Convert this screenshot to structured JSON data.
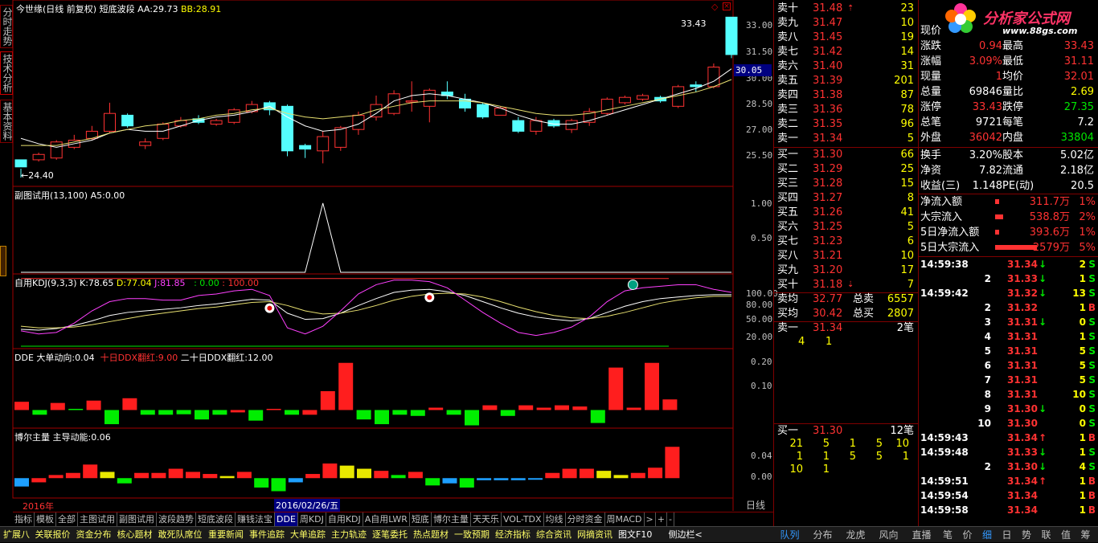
{
  "side_tabs": [
    {
      "label": "分时走势"
    },
    {
      "label": "技术分析"
    },
    {
      "label": "基本资料"
    }
  ],
  "main_panel": {
    "stock": "今世缘",
    "period": "(日线 前复权)",
    "indicator": "短底波段",
    "aa_label": "AA:",
    "aa_value": "29.73",
    "bb_label": "BB:",
    "bb_value": "28.91",
    "high_marker": "33.43",
    "low_marker": "24.40",
    "yaxis": [
      "33.00",
      "31.50",
      "30.00",
      "28.50",
      "27.00",
      "25.50"
    ],
    "current_price": "30.05"
  },
  "sub_panel": {
    "title": "副图试用(13,100)",
    "a5_label": "A5:",
    "a5_value": "0.00",
    "yaxis": [
      "1.00",
      "0.50"
    ]
  },
  "kdj_panel": {
    "title": "自用KDJ(9,3,3)",
    "k_label": "K:",
    "k_value": "78.65",
    "d_label": "D:",
    "d_value": "77.04",
    "j_label": "J:",
    "j_value": "81.85",
    "c1": ": 0.00",
    "c2": ": 100.00",
    "yaxis": [
      "100.00",
      "80.00",
      "50.00",
      "20.00"
    ]
  },
  "dde_panel": {
    "title": "DDE",
    "l1": "大单动向:",
    "v1": "0.04",
    "l2": "十日DDX翻红:",
    "v2": "9.00",
    "l3": "二十日DDX翻红:",
    "v3": "12.00",
    "yaxis": [
      "0.20",
      "0.10"
    ]
  },
  "boer_panel": {
    "title": "博尔主量",
    "l1": "主导动能:",
    "v1": "0.06",
    "yaxis": [
      "0.04",
      "0.00"
    ]
  },
  "time_axis": {
    "year": "2016年",
    "cursor_date": "2016/02/26/五"
  },
  "chart_data": [
    {
      "type": "candlestick",
      "title": "今世缘 (日线 前复权) 短底波段",
      "ylim": [
        24.0,
        34.0
      ],
      "candles": [
        [
          25.4,
          25.0,
          24.4,
          24.9
        ],
        [
          25.4,
          25.7,
          25.3,
          25.8
        ],
        [
          25.5,
          26.4,
          25.4,
          26.5
        ],
        [
          26.1,
          26.5,
          26.0,
          26.8
        ],
        [
          26.6,
          27.0,
          26.5,
          27.3
        ],
        [
          27.0,
          28.0,
          26.9,
          28.6
        ],
        [
          27.9,
          27.3,
          27.2,
          28.0
        ],
        [
          26.2,
          26.4,
          26.0,
          26.6
        ],
        [
          26.6,
          27.4,
          26.5,
          27.5
        ],
        [
          27.3,
          27.6,
          27.2,
          27.8
        ],
        [
          27.7,
          27.5,
          27.4,
          27.9
        ],
        [
          27.4,
          27.6,
          27.3,
          27.7
        ],
        [
          27.5,
          28.2,
          27.4,
          28.3
        ],
        [
          28.1,
          28.5,
          28.0,
          28.7
        ],
        [
          28.6,
          28.2,
          27.9,
          28.7
        ],
        [
          28.4,
          25.9,
          25.6,
          28.5
        ],
        [
          26.2,
          26.0,
          25.5,
          26.3
        ],
        [
          25.9,
          26.7,
          25.2,
          27.0
        ],
        [
          26.1,
          27.2,
          25.9,
          27.3
        ],
        [
          27.1,
          27.9,
          26.8,
          28.1
        ],
        [
          27.8,
          28.5,
          27.6,
          29.0
        ],
        [
          28.0,
          29.1,
          27.9,
          29.3
        ],
        [
          28.7,
          28.7,
          28.1,
          29.8
        ],
        [
          28.4,
          29.3,
          27.5,
          29.4
        ],
        [
          29.2,
          29.0,
          28.8,
          29.8
        ],
        [
          28.8,
          28.3,
          28.1,
          29.1
        ],
        [
          28.5,
          27.8,
          27.7,
          28.6
        ],
        [
          27.9,
          28.3,
          27.9,
          28.4
        ],
        [
          27.6,
          27.0,
          26.9,
          27.8
        ],
        [
          27.0,
          27.6,
          26.8,
          27.8
        ],
        [
          27.6,
          27.3,
          27.2,
          27.7
        ],
        [
          27.1,
          27.6,
          26.9,
          27.7
        ],
        [
          27.5,
          28.1,
          27.3,
          28.3
        ],
        [
          28.0,
          28.8,
          27.9,
          28.9
        ],
        [
          28.6,
          28.9,
          28.5,
          29.0
        ],
        [
          28.8,
          29.0,
          28.7,
          29.1
        ],
        [
          28.9,
          28.7,
          28.6,
          29.0
        ],
        [
          28.4,
          29.5,
          28.3,
          29.6
        ],
        [
          29.6,
          29.5,
          29.2,
          29.8
        ],
        [
          29.5,
          30.6,
          29.4,
          30.8
        ],
        [
          33.4,
          31.3,
          31.1,
          33.4
        ]
      ],
      "ma_white": [
        26.6,
        26.3,
        26.1,
        26.3,
        26.5,
        26.9,
        27.1,
        27.0,
        27.0,
        27.3,
        27.6,
        27.8,
        27.9,
        28.1,
        28.4,
        27.8,
        27.3,
        27.0,
        27.1,
        27.4,
        28.0,
        28.7,
        29.0,
        29.1,
        29.0,
        28.8,
        28.6,
        28.3,
        27.9,
        27.6,
        27.4,
        27.4,
        27.6,
        27.9,
        28.2,
        28.5,
        28.8,
        29.1,
        29.4,
        29.8,
        30.5
      ],
      "ma_yellow": [
        26.2,
        26.2,
        26.2,
        26.4,
        26.6,
        26.9,
        27.1,
        27.3,
        27.4,
        27.6,
        27.7,
        27.9,
        28.0,
        28.2,
        28.3,
        28.0,
        27.8,
        27.7,
        27.8,
        27.9,
        28.2,
        28.4,
        28.6,
        28.7,
        28.7,
        28.7,
        28.6,
        28.4,
        28.2,
        28.0,
        27.9,
        27.9,
        28.0,
        28.2,
        28.4,
        28.6,
        28.8,
        29.0,
        29.2,
        29.5,
        29.9
      ]
    },
    {
      "type": "line",
      "title": "副图试用(13,100)",
      "ylim": [
        0,
        1.15
      ],
      "values": [
        0,
        0,
        0,
        0,
        0,
        0,
        0,
        0,
        0,
        0,
        0,
        0,
        0,
        0,
        0,
        0,
        0,
        1,
        0,
        0,
        0,
        0,
        0,
        0,
        0,
        0,
        0,
        0,
        0,
        0,
        0,
        0,
        0,
        0,
        0,
        0,
        0,
        0,
        0,
        0,
        0
      ]
    },
    {
      "type": "line",
      "title": "自用KDJ(9,3,3)",
      "ylim": [
        10,
        105
      ],
      "series": [
        {
          "name": "K",
          "values": [
            34,
            33,
            35,
            39,
            45,
            52,
            56,
            58,
            60,
            62,
            65,
            67,
            70,
            73,
            72,
            55,
            47,
            48,
            55,
            65,
            74,
            82,
            85,
            86,
            83,
            78,
            70,
            62,
            55,
            50,
            47,
            45,
            48,
            56,
            64,
            70,
            74,
            76,
            78,
            79,
            79
          ]
        },
        {
          "name": "D",
          "values": [
            38,
            36,
            36,
            37,
            40,
            44,
            48,
            52,
            55,
            58,
            61,
            63,
            66,
            69,
            70,
            65,
            58,
            54,
            55,
            59,
            65,
            72,
            77,
            80,
            81,
            80,
            76,
            70,
            63,
            57,
            52,
            49,
            48,
            51,
            56,
            62,
            68,
            72,
            75,
            77,
            77
          ]
        },
        {
          "name": "J",
          "values": [
            32,
            28,
            30,
            42,
            58,
            70,
            74,
            74,
            72,
            72,
            78,
            80,
            84,
            86,
            78,
            36,
            28,
            38,
            58,
            80,
            92,
            98,
            98,
            96,
            88,
            72,
            56,
            42,
            30,
            26,
            30,
            37,
            50,
            70,
            84,
            88,
            90,
            92,
            92,
            86,
            82
          ]
        }
      ],
      "signals": [
        {
          "index": 14,
          "type": "buy"
        },
        {
          "index": 23,
          "type": "buy"
        },
        {
          "index": 34,
          "type": "top"
        }
      ]
    },
    {
      "type": "bar",
      "title": "DDE",
      "ylim": [
        -0.07,
        0.24
      ],
      "values": [
        0.035,
        -0.02,
        0.03,
        0.005,
        0.04,
        -0.06,
        0.05,
        -0.02,
        -0.02,
        -0.018,
        -0.04,
        -0.02,
        -0.01,
        -0.045,
        0.005,
        -0.02,
        -0.02,
        0.08,
        0.2,
        -0.04,
        -0.06,
        -0.02,
        -0.025,
        0.01,
        -0.02,
        -0.065,
        0.02,
        -0.025,
        0.02,
        0.01,
        0.02,
        0.015,
        -0.055,
        0.18,
        0.01,
        0.2,
        0.045
      ],
      "colors": [
        "r",
        "g",
        "r",
        "g",
        "r",
        "g",
        "r",
        "g",
        "g",
        "g",
        "g",
        "g",
        "r",
        "g",
        "r",
        "g",
        "r",
        "r",
        "r",
        "g",
        "g",
        "g",
        "g",
        "r",
        "g",
        "g",
        "r",
        "g",
        "r",
        "r",
        "r",
        "r",
        "g",
        "r",
        "r",
        "r",
        "r"
      ]
    },
    {
      "type": "bar",
      "title": "博尔主量",
      "ylim": [
        -0.035,
        0.085
      ],
      "values": [
        -0.016,
        -0.008,
        0.006,
        0.01,
        0.026,
        0.012,
        -0.01,
        0.01,
        0.01,
        0.018,
        0.012,
        0.008,
        0.004,
        0.012,
        -0.018,
        -0.025,
        -0.008,
        0.008,
        0.028,
        0.024,
        0.018,
        0.014,
        0.006,
        0.012,
        -0.014,
        -0.01,
        -0.018,
        -0.004,
        -0.004,
        -0.004,
        -0.002,
        0.01,
        0.018,
        0.018,
        0.014,
        0.006,
        0.01,
        0.02,
        0.06
      ],
      "colors": [
        "c",
        "r",
        "r",
        "r",
        "r",
        "y",
        "g",
        "r",
        "r",
        "r",
        "r",
        "r",
        "y",
        "r",
        "g",
        "g",
        "c",
        "r",
        "r",
        "y",
        "y",
        "r",
        "g",
        "r",
        "g",
        "c",
        "g",
        "c",
        "c",
        "c",
        "c",
        "r",
        "r",
        "r",
        "y",
        "y",
        "r",
        "r",
        "r"
      ]
    }
  ],
  "orderbook": {
    "sells": [
      {
        "label": "卖十",
        "price": "31.48",
        "vol": "23",
        "arrow": "up"
      },
      {
        "label": "卖九",
        "price": "31.47",
        "vol": "10"
      },
      {
        "label": "卖八",
        "price": "31.45",
        "vol": "19"
      },
      {
        "label": "卖七",
        "price": "31.42",
        "vol": "14"
      },
      {
        "label": "卖六",
        "price": "31.40",
        "vol": "31"
      },
      {
        "label": "卖五",
        "price": "31.39",
        "vol": "201"
      },
      {
        "label": "卖四",
        "price": "31.38",
        "vol": "87"
      },
      {
        "label": "卖三",
        "price": "31.36",
        "vol": "78"
      },
      {
        "label": "卖二",
        "price": "31.35",
        "vol": "96"
      },
      {
        "label": "卖一",
        "price": "31.34",
        "vol": "5"
      }
    ],
    "buys": [
      {
        "label": "买一",
        "price": "31.30",
        "vol": "66"
      },
      {
        "label": "买二",
        "price": "31.29",
        "vol": "25"
      },
      {
        "label": "买三",
        "price": "31.28",
        "vol": "15"
      },
      {
        "label": "买四",
        "price": "31.27",
        "vol": "8"
      },
      {
        "label": "买五",
        "price": "31.26",
        "vol": "41"
      },
      {
        "label": "买六",
        "price": "31.25",
        "vol": "5"
      },
      {
        "label": "买七",
        "price": "31.23",
        "vol": "6"
      },
      {
        "label": "买八",
        "price": "31.21",
        "vol": "10"
      },
      {
        "label": "买九",
        "price": "31.20",
        "vol": "17"
      },
      {
        "label": "买十",
        "price": "31.18",
        "vol": "7",
        "arrow": "down"
      }
    ],
    "avg_sell_label": "卖均",
    "avg_sell": "32.77",
    "total_sell_label": "总卖",
    "total_sell": "6557",
    "avg_buy_label": "买均",
    "avg_buy": "30.42",
    "total_buy_label": "总买",
    "total_buy": "2807",
    "sell1_label": "卖一",
    "sell1_price": "31.34",
    "sell1_count": "2笔",
    "sell1_q1": "4",
    "sell1_q2": "1",
    "buy1_label": "买一",
    "buy1_price": "31.30",
    "buy1_count": "12笔",
    "buy1_queue": [
      [
        "21",
        "5",
        "1",
        "5",
        "10"
      ],
      [
        "1",
        "1",
        "5",
        "5",
        "1"
      ],
      [
        "10",
        "1",
        "",
        "",
        ""
      ]
    ]
  },
  "logo": {
    "text": "分析家公式网",
    "url": "www.88gs.com"
  },
  "quote": {
    "rows": [
      {
        "l1": "现价",
        "v1": "",
        "l2": "",
        "v2": ""
      },
      {
        "l1": "涨跌",
        "v1": "0.94",
        "l2": "最高",
        "v2": "33.43"
      },
      {
        "l1": "涨幅",
        "v1": "3.09%",
        "l2": "最低",
        "v2": "31.11"
      },
      {
        "l1": "现量",
        "v1": "1",
        "l2": "均价",
        "v2": "32.01"
      },
      {
        "l1": "总量",
        "v1": "69846",
        "l2": "量比",
        "v2": "2.69"
      },
      {
        "l1": "涨停",
        "v1": "33.43",
        "l2": "跌停",
        "v2": "27.35"
      },
      {
        "l1": "总笔",
        "v1": "9721",
        "l2": "每笔",
        "v2": "7.2"
      },
      {
        "l1": "外盘",
        "v1": "36042",
        "l2": "内盘",
        "v2": "33804"
      }
    ],
    "rows2": [
      {
        "l1": "换手",
        "v1": "3.20%",
        "l2": "股本",
        "v2": "5.02亿"
      },
      {
        "l1": "净资",
        "v1": "7.82",
        "l2": "流通",
        "v2": "2.18亿"
      },
      {
        "l1": "收益(三)",
        "v1": "1.148",
        "l2": "PE(动)",
        "v2": "20.5"
      }
    ],
    "flows": [
      {
        "label": "净流入额",
        "value": "311.7万",
        "pct": "1%",
        "bar": 0.1
      },
      {
        "label": "大宗流入",
        "value": "538.8万",
        "pct": "2%",
        "bar": 0.2
      },
      {
        "label": "5日净流入额",
        "value": "393.6万",
        "pct": "1%",
        "bar": 0.1
      },
      {
        "label": "5日大宗流入",
        "value": "2579万",
        "pct": "5%",
        "bar": 1.0
      }
    ],
    "ticks": [
      {
        "time": "14:59:38",
        "price": "31.34",
        "dir": "down",
        "vol": "2",
        "bs": "S"
      },
      {
        "time": "2",
        "price": "31.33",
        "dir": "down",
        "vol": "1",
        "bs": "S"
      },
      {
        "time": "14:59:42",
        "price": "31.32",
        "dir": "down",
        "vol": "13",
        "bs": "S"
      },
      {
        "time": "2",
        "price": "31.32",
        "dir": "",
        "vol": "1",
        "bs": "B"
      },
      {
        "time": "3",
        "price": "31.31",
        "dir": "down",
        "vol": "0",
        "bs": "S"
      },
      {
        "time": "4",
        "price": "31.31",
        "dir": "",
        "vol": "1",
        "bs": "S"
      },
      {
        "time": "5",
        "price": "31.31",
        "dir": "",
        "vol": "5",
        "bs": "S"
      },
      {
        "time": "6",
        "price": "31.31",
        "dir": "",
        "vol": "5",
        "bs": "S"
      },
      {
        "time": "7",
        "price": "31.31",
        "dir": "",
        "vol": "5",
        "bs": "S"
      },
      {
        "time": "8",
        "price": "31.31",
        "dir": "",
        "vol": "10",
        "bs": "S"
      },
      {
        "time": "9",
        "price": "31.30",
        "dir": "down",
        "vol": "0",
        "bs": "S"
      },
      {
        "time": "10",
        "price": "31.30",
        "dir": "",
        "vol": "0",
        "bs": "S"
      },
      {
        "time": "14:59:43",
        "price": "31.34",
        "dir": "up",
        "vol": "1",
        "bs": "B"
      },
      {
        "time": "14:59:48",
        "price": "31.33",
        "dir": "down",
        "vol": "1",
        "bs": "S"
      },
      {
        "time": "2",
        "price": "31.30",
        "dir": "down",
        "vol": "4",
        "bs": "S"
      },
      {
        "time": "14:59:51",
        "price": "31.34",
        "dir": "up",
        "vol": "1",
        "bs": "B"
      },
      {
        "time": "14:59:54",
        "price": "31.34",
        "dir": "",
        "vol": "1",
        "bs": "B"
      },
      {
        "time": "14:59:58",
        "price": "31.34",
        "dir": "",
        "vol": "1",
        "bs": "B"
      }
    ]
  },
  "indicator_tabs": [
    "指标",
    "模板",
    "全部",
    "主图试用",
    "副图试用",
    "波段趋势",
    "短底波段",
    "赚钱法宝",
    "DDE",
    "周KDJ",
    "自用KDJ",
    "A自用LWR",
    "短底",
    "博尔主量",
    "天天乐",
    "VOL-TDX",
    "均线",
    "分时资金",
    "周MACD",
    ">",
    "+",
    "-"
  ],
  "active_tab": "DDE",
  "period_label": "日线",
  "bottom_tabs": [
    "扩展八",
    "关联报价",
    "资金分布",
    "核心题材",
    "敢死队席位",
    "重要新闻",
    "事件追踪",
    "大单追踪",
    "主力轨迹",
    "逐笔委托",
    "热点题材",
    "一致预期",
    "经济指标",
    "综合资讯",
    "网摘资讯",
    "图文F10",
    "侧边栏<"
  ],
  "right_tabs": [
    "队列",
    "分布",
    "龙虎",
    "风向",
    "直播",
    "笔",
    "价",
    "细",
    "日",
    "势",
    "联",
    "值",
    "筹"
  ]
}
